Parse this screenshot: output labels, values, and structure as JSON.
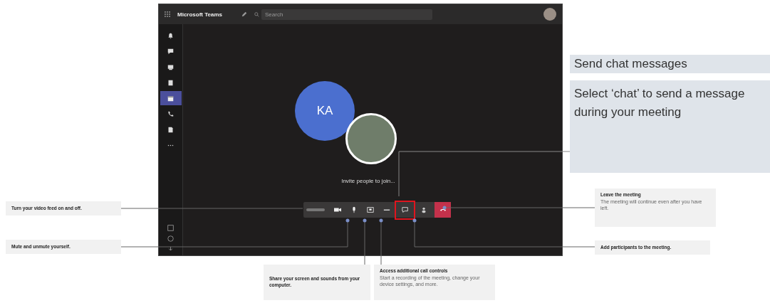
{
  "app": {
    "title": "Microsoft Teams",
    "search": {
      "placeholder": "Search"
    },
    "sidebar": {
      "items": [
        {
          "kind": "bell",
          "selected": false
        },
        {
          "kind": "chat",
          "selected": false
        },
        {
          "kind": "teams",
          "selected": false
        },
        {
          "kind": "assignments",
          "selected": false
        },
        {
          "kind": "calendar",
          "selected": true
        },
        {
          "kind": "calls",
          "selected": false
        },
        {
          "kind": "files",
          "selected": false
        },
        {
          "kind": "more",
          "selected": false
        }
      ]
    },
    "meeting": {
      "avatar_initials": "KA",
      "invite_text": "Invite people to join...",
      "controls": [
        {
          "kind": "timer",
          "highlighted": false
        },
        {
          "kind": "video",
          "highlighted": false
        },
        {
          "kind": "mic",
          "highlighted": false
        },
        {
          "kind": "share",
          "highlighted": false
        },
        {
          "kind": "more",
          "highlighted": false
        },
        {
          "kind": "chat",
          "highlighted": true
        },
        {
          "kind": "participants",
          "highlighted": false
        },
        {
          "kind": "hangup",
          "highlighted": false
        }
      ]
    }
  },
  "side_panel": {
    "heading": "Send chat messages",
    "body": "Select ‘chat’ to send a message during your meeting"
  },
  "annotations": [
    {
      "title": "Turn your video feed on and off."
    },
    {
      "title": "Mute and unmute yourself."
    },
    {
      "title": "Share your screen and sounds from your computer."
    },
    {
      "title": "Access additional call controls",
      "description": "Start a recording of the meeting, change your device settings, and more."
    },
    {
      "title": "Leave the meeting",
      "description": "The meeting will continue even after you have left."
    },
    {
      "title": "Add participants to the meeting."
    }
  ]
}
